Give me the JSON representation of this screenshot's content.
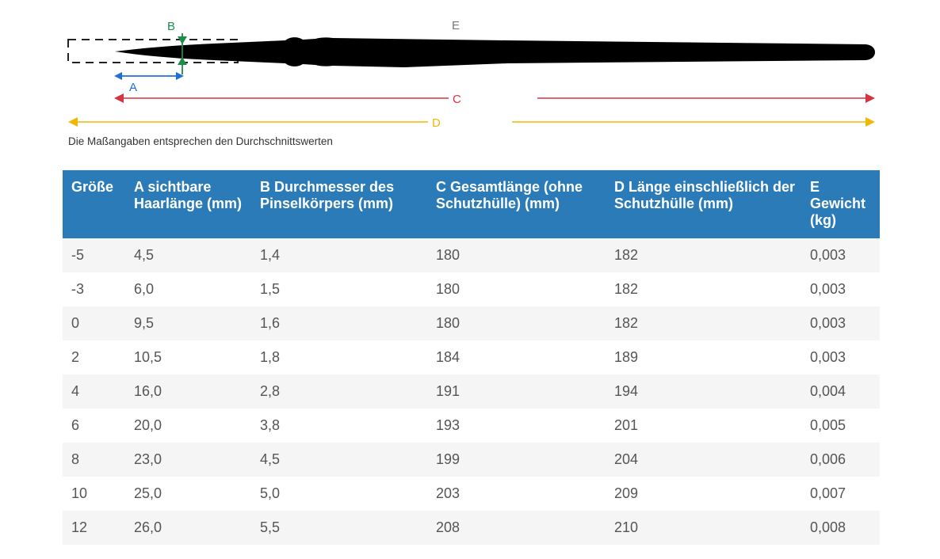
{
  "diagram": {
    "labels": {
      "a": "A",
      "b": "B",
      "c": "C",
      "d": "D",
      "e": "E"
    },
    "colors": {
      "a": "#1f6fd6",
      "b": "#1e8a4c",
      "c": "#d6323f",
      "d": "#f2b705",
      "e": "#777777",
      "brush": "#000000",
      "frame": "#222222"
    }
  },
  "caption": "Die Maßangaben entsprechen den Durchschnittswerten",
  "table": {
    "headers": [
      "Größe",
      "A sichtbare Haarlänge (mm)",
      "B Durchmesser des Pinselkörpers (mm)",
      "C Gesamtlänge (ohne Schutzhülle) (mm)",
      "D Länge einschließlich der Schutzhülle (mm)",
      "E Gewicht (kg)"
    ],
    "rows": [
      [
        "-5",
        "4,5",
        "1,4",
        "180",
        "182",
        "0,003"
      ],
      [
        "-3",
        "6,0",
        "1,5",
        "180",
        "182",
        "0,003"
      ],
      [
        "0",
        "9,5",
        "1,6",
        "180",
        "182",
        "0,003"
      ],
      [
        "2",
        "10,5",
        "1,8",
        "184",
        "189",
        "0,003"
      ],
      [
        "4",
        "16,0",
        "2,8",
        "191",
        "194",
        "0,004"
      ],
      [
        "6",
        "20,0",
        "3,8",
        "193",
        "201",
        "0,005"
      ],
      [
        "8",
        "23,0",
        "4,5",
        "199",
        "204",
        "0,006"
      ],
      [
        "10",
        "25,0",
        "5,0",
        "203",
        "209",
        "0,007"
      ],
      [
        "12",
        "26,0",
        "5,5",
        "208",
        "210",
        "0,008"
      ]
    ]
  }
}
